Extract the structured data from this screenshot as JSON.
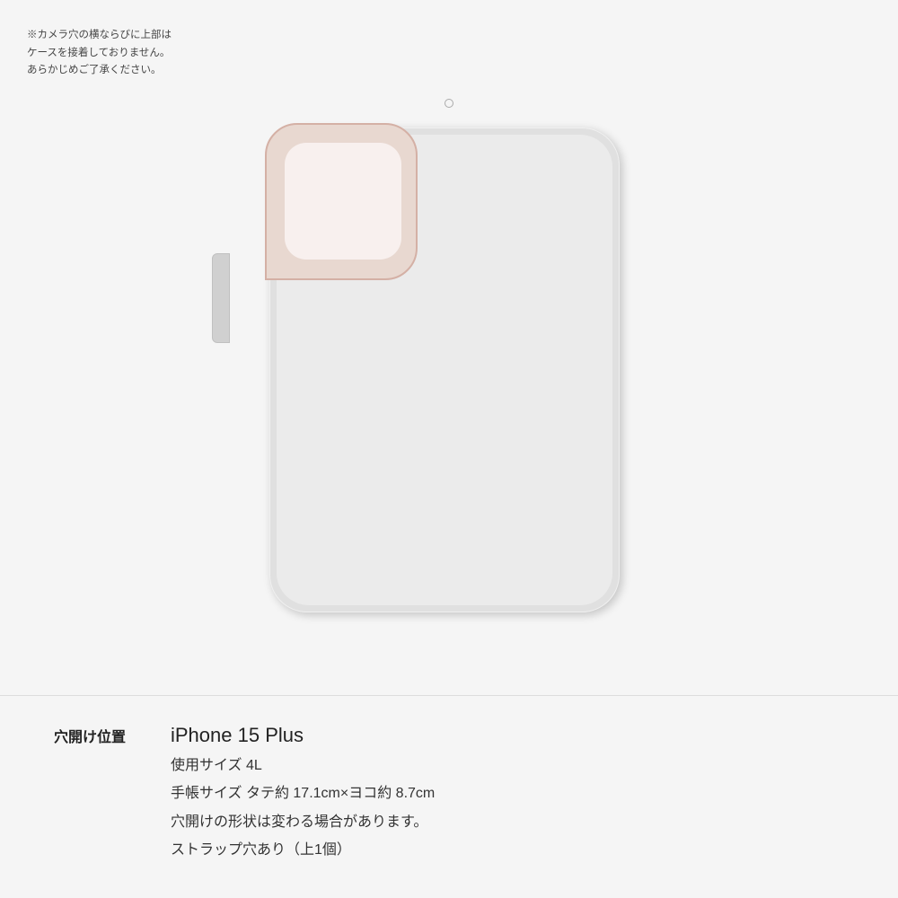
{
  "page": {
    "background_color": "#f5f5f5"
  },
  "note": {
    "text": "※カメラ穴の横ならびに上部は\nケースを接着しておりません。\nあらかじめご了承ください。"
  },
  "label": {
    "hole_position": "穴開け位置"
  },
  "device": {
    "name": "iPhone 15 Plus",
    "size_label": "使用サイズ 4L",
    "dimensions": "手帳サイズ タテ約 17.1cm×ヨコ約 8.7cm",
    "hole_note": "穴開けの形状は変わる場合があります。",
    "strap": "ストラップ穴あり（上1個）"
  }
}
